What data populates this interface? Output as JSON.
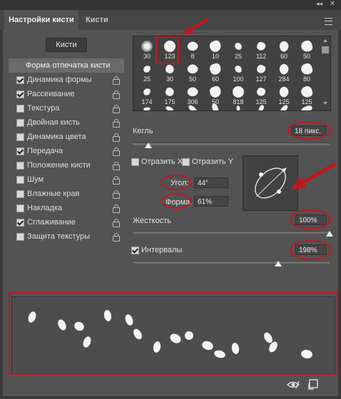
{
  "tabs": {
    "active": "Настройки кисти",
    "inactive": "Кисти"
  },
  "brushes_button": "Кисти",
  "options": [
    {
      "label": "Форма отпечатка кисти",
      "checkbox": false,
      "checked": false,
      "selected": true
    },
    {
      "label": "Динамика формы",
      "checkbox": true,
      "checked": true
    },
    {
      "label": "Рассеивание",
      "checkbox": true,
      "checked": true
    },
    {
      "label": "Текстура",
      "checkbox": true,
      "checked": false
    },
    {
      "label": "Двойная кисть",
      "checkbox": true,
      "checked": false
    },
    {
      "label": "Динамика цвета",
      "checkbox": true,
      "checked": false
    },
    {
      "label": "Передача",
      "checkbox": true,
      "checked": true
    },
    {
      "label": "Положение кисти",
      "checkbox": true,
      "checked": false
    },
    {
      "label": "Шум",
      "checkbox": true,
      "checked": false
    },
    {
      "label": "Влажные края",
      "checkbox": true,
      "checked": false
    },
    {
      "label": "Накладка",
      "checkbox": true,
      "checked": false
    },
    {
      "label": "Сглаживание",
      "checkbox": true,
      "checked": true
    },
    {
      "label": "Защита текстуры",
      "checkbox": true,
      "checked": false
    }
  ],
  "brush_grid": {
    "rows": [
      [
        "30",
        "123",
        "8",
        "10",
        "25",
        "112",
        "60",
        "50"
      ],
      [
        "25",
        "30",
        "50",
        "60",
        "100",
        "127",
        "284",
        "80"
      ],
      [
        "174",
        "175",
        "306",
        "50",
        "818",
        "125",
        "125",
        "125"
      ],
      [
        "",
        "",
        "",
        "",
        "",
        "",
        "",
        ""
      ]
    ],
    "selected": "123"
  },
  "size": {
    "label": "Кегль",
    "value": "18 пикс."
  },
  "flip_x": {
    "label": "Отразить X",
    "checked": false
  },
  "flip_y": {
    "label": "Отразить Y",
    "checked": false
  },
  "angle": {
    "label": "Угол:",
    "value": "44°"
  },
  "roundness": {
    "label": "Форма:",
    "value": "61%"
  },
  "hardness": {
    "label": "Жесткость",
    "value": "100%",
    "level": 1.0
  },
  "spacing": {
    "label": "Интервалы",
    "value": "198%",
    "checked": true,
    "level": 0.198
  },
  "colors": {
    "highlight": "#c0171e",
    "panel": "#535353",
    "dark": "#424242"
  }
}
